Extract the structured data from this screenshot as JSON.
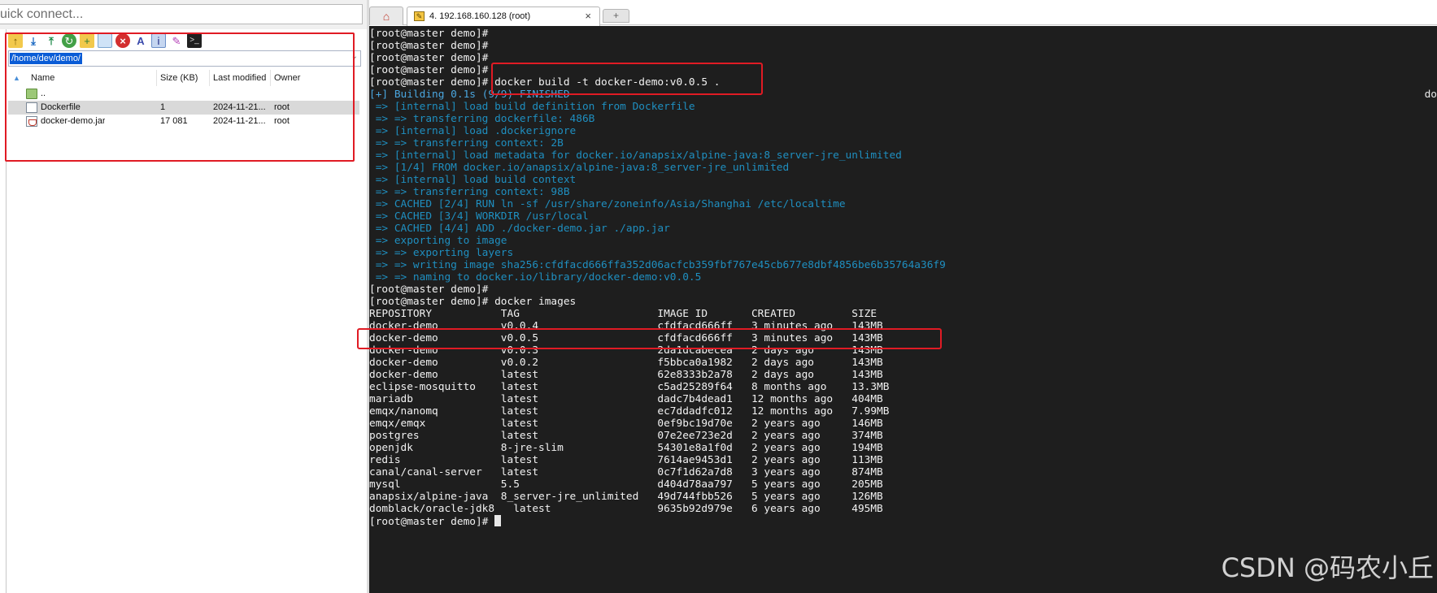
{
  "quick_connect": {
    "text": "uick connect..."
  },
  "browser": {
    "toolbar_icons": [
      "folder-up-icon",
      "download-icon",
      "upload-icon",
      "refresh-icon",
      "new-folder-icon",
      "new-file-icon",
      "delete-icon",
      "rename-icon",
      "properties-icon",
      "settings-icon",
      "terminal-icon"
    ],
    "path": "/home/dev/demo/",
    "columns": {
      "name": "Name",
      "size": "Size (KB)",
      "modified": "Last modified",
      "owner": "Owner"
    },
    "files": [
      {
        "name": "..",
        "size": "",
        "modified": "",
        "owner": "",
        "icon": "folder-up-icon"
      },
      {
        "name": "Dockerfile",
        "size": "1",
        "modified": "2024-11-21...",
        "owner": "root",
        "icon": "file-icon"
      },
      {
        "name": "docker-demo.jar",
        "size": "17 081",
        "modified": "2024-11-21...",
        "owner": "root",
        "icon": "jar-icon"
      }
    ]
  },
  "tabs": {
    "home_icon": "home-icon",
    "session_title": "4. 192.168.160.128 (root)",
    "close_glyph": "×",
    "new_tab_glyph": "+"
  },
  "terminal": {
    "lines": [
      {
        "text": "[root@master demo]#",
        "kind": "prompt"
      },
      {
        "text": "[root@master demo]#",
        "kind": "prompt"
      },
      {
        "text": "[root@master demo]#",
        "kind": "prompt"
      },
      {
        "text": "[root@master demo]#",
        "kind": "prompt"
      },
      {
        "text": "[root@master demo]# docker build -t docker-demo:v0.0.5 .",
        "kind": "prompt"
      },
      {
        "text": "[+] Building 0.1s (9/9) FINISHED",
        "kind": "bright"
      },
      {
        "text": " => [internal] load build definition from Dockerfile",
        "kind": "out"
      },
      {
        "text": " => => transferring dockerfile: 486B",
        "kind": "out"
      },
      {
        "text": " => [internal] load .dockerignore",
        "kind": "out"
      },
      {
        "text": " => => transferring context: 2B",
        "kind": "out"
      },
      {
        "text": " => [internal] load metadata for docker.io/anapsix/alpine-java:8_server-jre_unlimited",
        "kind": "out"
      },
      {
        "text": " => [1/4] FROM docker.io/anapsix/alpine-java:8_server-jre_unlimited",
        "kind": "out"
      },
      {
        "text": " => [internal] load build context",
        "kind": "out"
      },
      {
        "text": " => => transferring context: 98B",
        "kind": "out"
      },
      {
        "text": " => CACHED [2/4] RUN ln -sf /usr/share/zoneinfo/Asia/Shanghai /etc/localtime",
        "kind": "out"
      },
      {
        "text": " => CACHED [3/4] WORKDIR /usr/local",
        "kind": "out"
      },
      {
        "text": " => CACHED [4/4] ADD ./docker-demo.jar ./app.jar",
        "kind": "out"
      },
      {
        "text": " => exporting to image",
        "kind": "out"
      },
      {
        "text": " => => exporting layers",
        "kind": "out"
      },
      {
        "text": " => => writing image sha256:cfdfacd666ffa352d06acfcb359fbf767e45cb677e8dbf4856be6b35764a36f9",
        "kind": "out"
      },
      {
        "text": " => => naming to docker.io/library/docker-demo:v0.0.5",
        "kind": "out"
      },
      {
        "text": "[root@master demo]#",
        "kind": "prompt"
      },
      {
        "text": "[root@master demo]# docker images",
        "kind": "prompt"
      },
      {
        "text": "REPOSITORY           TAG                      IMAGE ID       CREATED         SIZE",
        "kind": "prompt"
      },
      {
        "text": "docker-demo          v0.0.4                   cfdfacd666ff   3 minutes ago   143MB",
        "kind": "prompt"
      },
      {
        "text": "docker-demo          v0.0.5                   cfdfacd666ff   3 minutes ago   143MB",
        "kind": "prompt"
      },
      {
        "text": "docker-demo          v0.0.3                   2da1dcabecea   2 days ago      143MB",
        "kind": "prompt"
      },
      {
        "text": "docker-demo          v0.0.2                   f5bbca0a1982   2 days ago      143MB",
        "kind": "prompt"
      },
      {
        "text": "docker-demo          latest                   62e8333b2a78   2 days ago      143MB",
        "kind": "prompt"
      },
      {
        "text": "eclipse-mosquitto    latest                   c5ad25289f64   8 months ago    13.3MB",
        "kind": "prompt"
      },
      {
        "text": "mariadb              latest                   dadc7b4dead1   12 months ago   404MB",
        "kind": "prompt"
      },
      {
        "text": "emqx/nanomq          latest                   ec7ddadfc012   12 months ago   7.99MB",
        "kind": "prompt"
      },
      {
        "text": "emqx/emqx            latest                   0ef9bc19d70e   2 years ago     146MB",
        "kind": "prompt"
      },
      {
        "text": "postgres             latest                   07e2ee723e2d   2 years ago     374MB",
        "kind": "prompt"
      },
      {
        "text": "openjdk              8-jre-slim               54301e8a1f0d   2 years ago     194MB",
        "kind": "prompt"
      },
      {
        "text": "redis                latest                   7614ae9453d1   2 years ago     113MB",
        "kind": "prompt"
      },
      {
        "text": "canal/canal-server   latest                   0c7f1d62a7d8   3 years ago     874MB",
        "kind": "prompt"
      },
      {
        "text": "mysql                5.5                      d404d78aa797   5 years ago     205MB",
        "kind": "prompt"
      },
      {
        "text": "anapsix/alpine-java  8_server-jre_unlimited   49d744fbb526   5 years ago     126MB",
        "kind": "prompt"
      },
      {
        "text": "domblack/oracle-jdk8   latest                 9635b92d979e   6 years ago     495MB",
        "kind": "prompt"
      }
    ],
    "final_prompt": "[root@master demo]# ",
    "right_edge_text": "do"
  },
  "watermark": "CSDN @码农小丘",
  "colors": {
    "highlight_box": "#e01b24",
    "terminal_bg": "#1e1e1e",
    "output_text": "#1f8fc0",
    "selection": "#0a5cd6"
  }
}
